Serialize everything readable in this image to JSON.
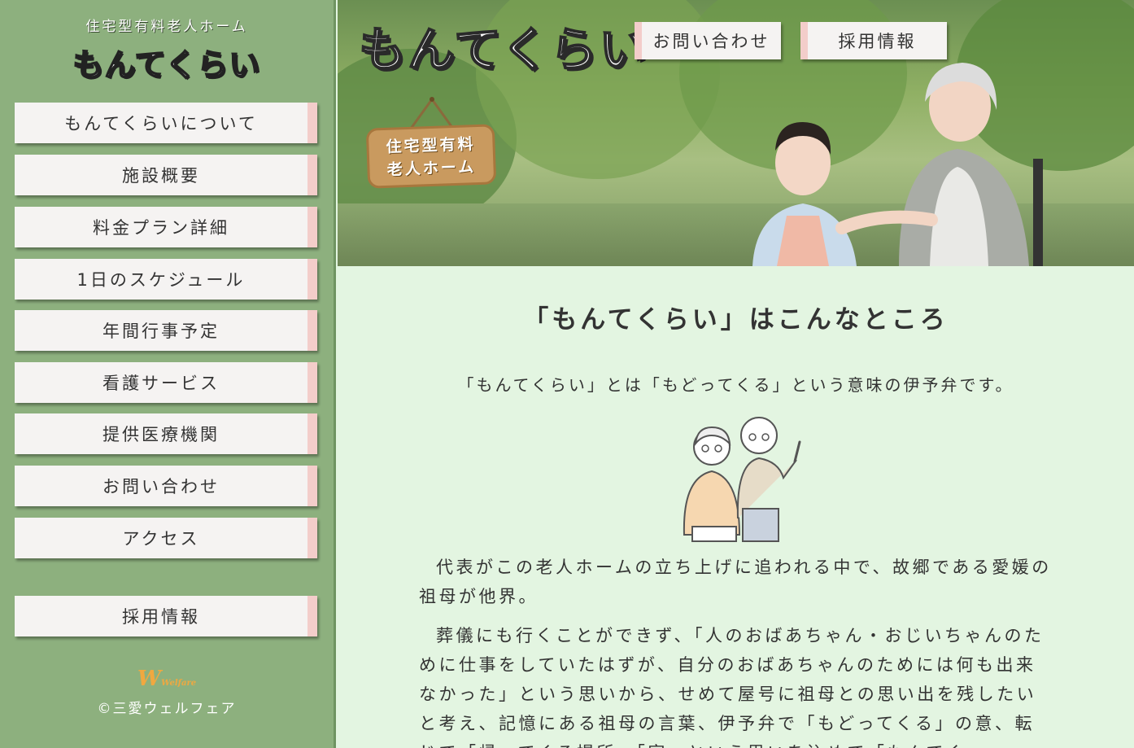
{
  "sidebar": {
    "subtitle": "住宅型有料老人ホーム",
    "title": "もんてくらい",
    "menu": [
      {
        "label": "もんてくらいについて"
      },
      {
        "label": "施設概要"
      },
      {
        "label": "料金プラン詳細"
      },
      {
        "label": "1日のスケジュール"
      },
      {
        "label": "年間行事予定"
      },
      {
        "label": "看護サービス"
      },
      {
        "label": "提供医療機関"
      },
      {
        "label": "お問い合わせ"
      },
      {
        "label": "アクセス"
      }
    ],
    "recruit_label": "採用情報",
    "footer_logo": "Welfare",
    "copyright": "©三愛ウェルフェア"
  },
  "header": {
    "logo": "もんてくらい",
    "contact_label": "お問い合わせ",
    "recruit_label": "採用情報",
    "sign_line1": "住宅型有料",
    "sign_line2": "老人ホーム"
  },
  "main": {
    "title": "「もんてくらい」はこんなところ",
    "lead": "「もんてくらい」とは「もどってくる」という意味の伊予弁です。",
    "paragraphs": [
      "代表がこの老人ホームの立ち上げに追われる中で、故郷である愛媛の祖母が他界。",
      "葬儀にも行くことができず、「人のおばあちゃん・おじいちゃんのために仕事をしていたはずが、自分のおばあちゃんのためには何も出来なかった」という思いから、せめて屋号に祖母との思い出を残したいと考え、記憶にある祖母の言葉、伊予弁で「もどってくる」の意、転じて「帰ってくる場所」「家」という思いを込めて「もんてく"
    ]
  },
  "colors": {
    "sidebar_bg": "#8db07e",
    "main_bg": "#e3f5e1",
    "button_accent": "#f3cdca",
    "button_bg": "#f5f3f2"
  }
}
